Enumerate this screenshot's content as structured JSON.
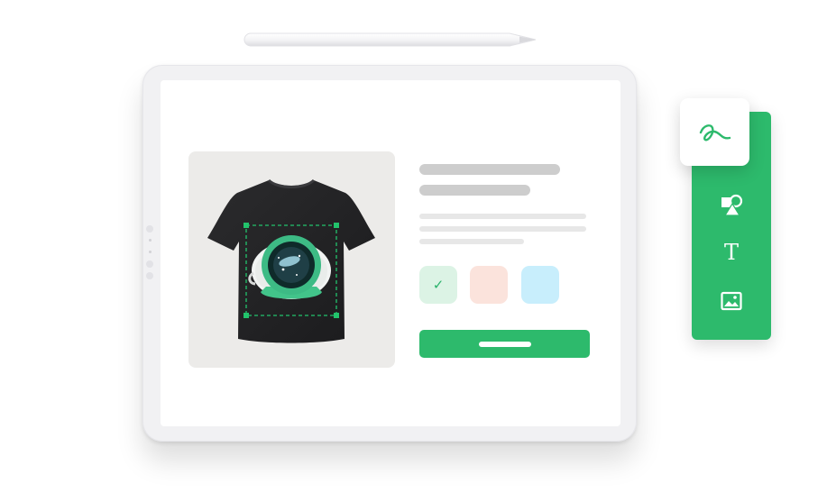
{
  "pencil": {
    "icon": "stylus-pencil"
  },
  "tablet": {
    "product": {
      "image": "black-tshirt-astronaut-helmet-print",
      "selection": "dashed-green-selection-box"
    },
    "swatches": [
      {
        "color": "#dcf3e5",
        "selected": true,
        "icon": "checkmark-icon",
        "mark": "✓"
      },
      {
        "color": "#fbe3dc",
        "selected": false
      },
      {
        "color": "#c8eefc",
        "selected": false
      }
    ],
    "cta": {
      "color": "#2dba6c"
    }
  },
  "toolbar": {
    "color": "#2dba6c",
    "tools": [
      {
        "name": "draw",
        "icon": "freehand-draw-icon",
        "active": true
      },
      {
        "name": "shapes",
        "icon": "shapes-icon",
        "active": false
      },
      {
        "name": "text",
        "icon": "text-tool-icon",
        "label": "T",
        "active": false
      },
      {
        "name": "image",
        "icon": "image-icon",
        "active": false
      }
    ]
  }
}
